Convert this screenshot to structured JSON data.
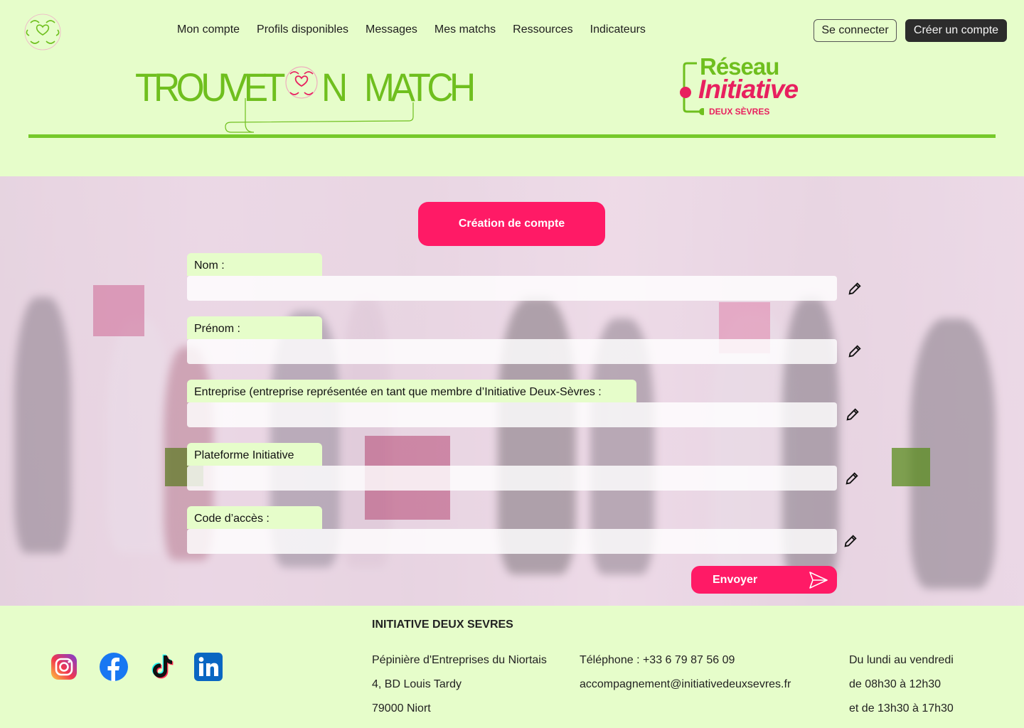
{
  "nav": {
    "items": [
      "Mon compte",
      "Profils disponibles",
      "Messages",
      "Mes matchs",
      "Ressources",
      "Indicateurs"
    ],
    "login_label": "Se connecter",
    "signup_label": "Créer un compte"
  },
  "brand": {
    "word1": "TROUVE",
    "word2a": "T",
    "word2b": "N",
    "word3": "MATCH",
    "partner_line1": "Réseau",
    "partner_line2": "Initiative",
    "partner_line3": "DEUX SÈVRES"
  },
  "form": {
    "title": "Création de compte",
    "fields": [
      {
        "label": "Nom :",
        "value": ""
      },
      {
        "label": "Prénom :",
        "value": ""
      },
      {
        "label": "Entreprise (entreprise représentée en tant que membre d’Initiative Deux-Sèvres :",
        "value": ""
      },
      {
        "label": "Plateforme Initiative",
        "value": ""
      },
      {
        "label": "Code d’accès :",
        "value": ""
      }
    ],
    "submit_label": "Envoyer"
  },
  "footer": {
    "org_name": "INITIATIVE DEUX SEVRES",
    "address": [
      "Pépinière d'Entreprises du Niortais",
      "4, BD Louis Tardy",
      "79000 Niort"
    ],
    "contact": [
      "Téléphone : +33 6 79 87 56 09",
      "accompagnement@initiativedeuxsevres.fr"
    ],
    "hours": [
      "Du lundi au vendredi",
      "de 08h30 à 12h30",
      "et de 13h30 à 17h30"
    ],
    "social": [
      "instagram-icon",
      "facebook-icon",
      "tiktok-icon",
      "linkedin-icon"
    ]
  },
  "colors": {
    "background": "#e6fdca",
    "accent_green": "#76c92a",
    "accent_pink": "#ff1a66",
    "dark_button": "#2c2c2c"
  }
}
